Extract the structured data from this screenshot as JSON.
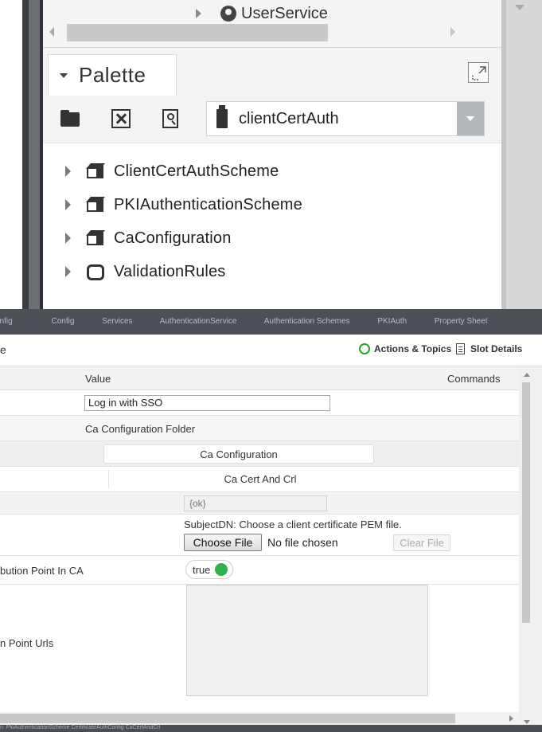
{
  "nav_tree": {
    "item_label": "UserService"
  },
  "palette": {
    "title": "Palette",
    "module_select": "clientCertAuth",
    "items": [
      {
        "label": "ClientCertAuthScheme",
        "icon": "cube-icon"
      },
      {
        "label": "PKIAuthenticationScheme",
        "icon": "cube-icon"
      },
      {
        "label": "CaConfiguration",
        "icon": "cube-icon"
      },
      {
        "label": "ValidationRules",
        "icon": "folder-icon"
      }
    ]
  },
  "breadcrumbs": {
    "items": [
      "onfig",
      "Config",
      "Services",
      "AuthenticationService",
      "Authentication Schemes",
      "PKIAuth",
      "Property Sheet"
    ]
  },
  "property_sheet": {
    "title": "e",
    "actions_label": "Actions & Topics",
    "slot_details_label": "Slot Details",
    "columns": {
      "value": "Value",
      "commands": "Commands"
    },
    "rows": {
      "login_button_text": "Log in with SSO",
      "ca_folder": "Ca Configuration Folder",
      "ca_configuration": "Ca Configuration",
      "ca_cert_and_crl": "Ca Cert And Crl",
      "status": "{ok}",
      "subject_dn_note": "SubjectDN: Choose a client certificate PEM file.",
      "choose_file_label": "Choose File",
      "no_file_label": "No file chosen",
      "clear_file_label": "Clear File",
      "crl_dp_in_ca_label": "bution Point In CA",
      "crl_dp_in_ca_value": "true",
      "crl_dp_urls_label": "n Point Urls"
    }
  },
  "status_bar": {
    "path_text": "n:  PkiAuthenticationScheme  CertificateAuthConfig  CaCertAndCrl"
  },
  "colors": {
    "status_ok_green": "#2eb34a",
    "nav_strip": "#4d5056",
    "select_arrow_bg": "#b5b8bb"
  }
}
